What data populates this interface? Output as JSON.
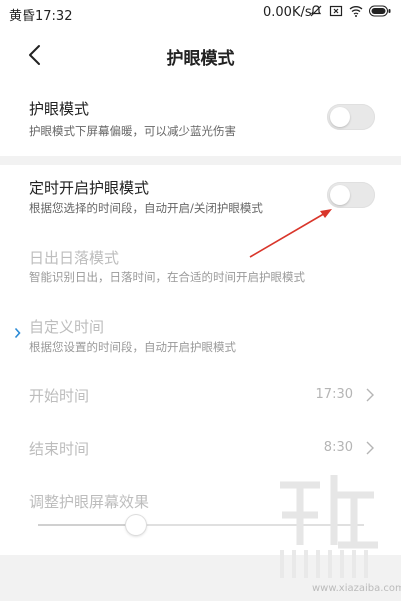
{
  "status_bar": {
    "time": "黄昏17:32",
    "network_speed": "0.00K/s",
    "icons": [
      "mute-icon",
      "sim-x-icon",
      "wifi-icon",
      "battery-icon"
    ]
  },
  "header": {
    "title": "护眼模式"
  },
  "eye_mode": {
    "title": "护眼模式",
    "subtitle": "护眼模式下屏幕偏暖，可以减少蓝光伤害",
    "enabled": false
  },
  "scheduled": {
    "title": "定时开启护眼模式",
    "subtitle": "根据您选择的时间段，自动开启/关闭护眼模式",
    "enabled": false
  },
  "sunrise": {
    "title": "日出日落模式",
    "subtitle": "智能识别日出，日落时间，在合适的时间开启护眼模式"
  },
  "custom_time": {
    "title": "自定义时间",
    "subtitle": "根据您设置的时间段，自动开启护眼模式"
  },
  "start_time": {
    "label": "开始时间",
    "value": "17:30"
  },
  "end_time": {
    "label": "结束时间",
    "value": "8:30"
  },
  "effect": {
    "label": "调整护眼屏幕效果",
    "level": 0.3
  },
  "watermark": {
    "text": "www.xiazaiba.com"
  },
  "colors": {
    "annotation_arrow": "#d9362b",
    "selected_marker": "#2b8bd6"
  }
}
